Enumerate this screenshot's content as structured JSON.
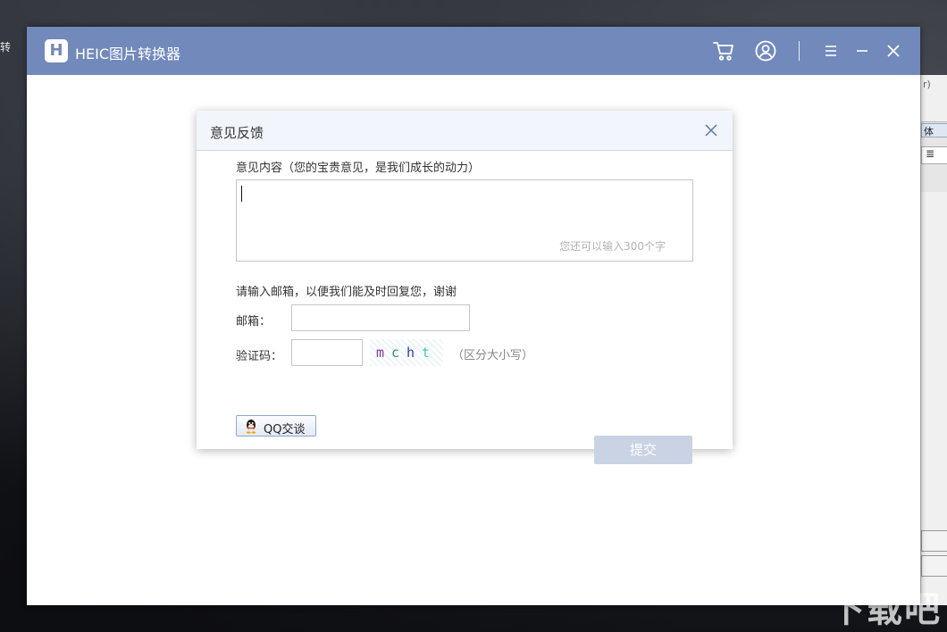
{
  "desktop": {
    "edge_text": "转",
    "watermark": "下载吧"
  },
  "background_app": {
    "row1": "r)",
    "tab": "体",
    "tab2": "≣"
  },
  "app": {
    "logo_letter": "H",
    "title": "HEIC图片转换器",
    "accent_color": "#7189bb",
    "titlebar_icons": [
      "cart-icon",
      "user-icon",
      "menu-icon",
      "minimize-icon",
      "close-icon"
    ]
  },
  "dialog": {
    "title": "意见反馈",
    "feedback_label": "意见内容（您的宝贵意见，是我们成长的动力）",
    "feedback_value": "",
    "char_counter": "您还可以输入300个字",
    "email_prompt": "请输入邮箱，以便我们能及时回复您，谢谢",
    "email_label": "邮箱：",
    "email_value": "",
    "captcha_label": "验证码：",
    "captcha_value": "",
    "captcha_chars": [
      "m",
      "c",
      "h",
      "t"
    ],
    "case_hint": "（区分大小写）",
    "qq_button": "QQ交谈",
    "submit_button": "提交"
  }
}
